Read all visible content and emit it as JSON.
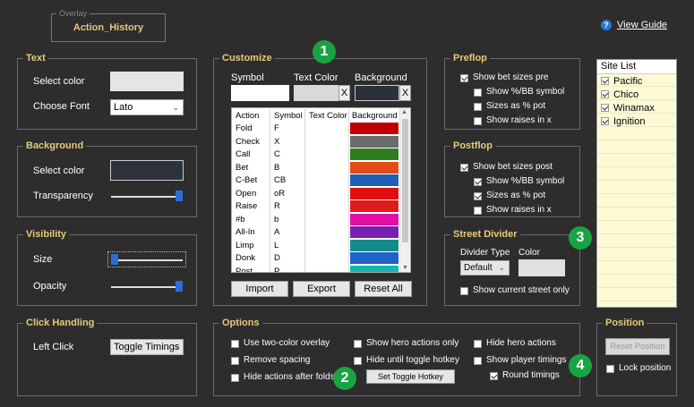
{
  "overlay": {
    "caption": "Overlay",
    "name": "Action_History"
  },
  "guide": {
    "label": "View Guide",
    "icon": "help-icon"
  },
  "text_group": {
    "title": "Text",
    "select_color": "Select color",
    "choose_font": "Choose Font",
    "font_value": "Lato",
    "swatch_color": "#e5e5e5"
  },
  "background_group": {
    "title": "Background",
    "select_color": "Select color",
    "transparency": "Transparency",
    "swatch_color": "#2c323a",
    "transparency_level": 1.0
  },
  "visibility_group": {
    "title": "Visibility",
    "size": "Size",
    "opacity": "Opacity",
    "size_level": 0.0,
    "opacity_level": 1.0
  },
  "click_group": {
    "title": "Click Handling",
    "left_click": "Left Click",
    "left_click_value": "Toggle Timings"
  },
  "customize": {
    "title": "Customize",
    "col_symbol": "Symbol",
    "col_text_color": "Text Color",
    "col_background": "Background",
    "clear": "X",
    "headers": [
      "Action",
      "Symbol",
      "Text Color",
      "Background"
    ],
    "rows": [
      {
        "action": "Fold",
        "symbol": "F",
        "color": "#c00000"
      },
      {
        "action": "Check",
        "symbol": "X",
        "color": "#6b6b6b"
      },
      {
        "action": "Call",
        "symbol": "C",
        "color": "#2e7d1e"
      },
      {
        "action": "Bet",
        "symbol": "B",
        "color": "#e54a17"
      },
      {
        "action": "C-Bet",
        "symbol": "CB",
        "color": "#1f5fb5"
      },
      {
        "action": "Open",
        "symbol": "oR",
        "color": "#e01010"
      },
      {
        "action": "Raise",
        "symbol": "R",
        "color": "#e01a1a"
      },
      {
        "action": "#b",
        "symbol": "b",
        "color": "#e20fa5"
      },
      {
        "action": "All-In",
        "symbol": "A",
        "color": "#7a1fb2"
      },
      {
        "action": "Limp",
        "symbol": "L",
        "color": "#168a8a"
      },
      {
        "action": "Donk",
        "symbol": "D",
        "color": "#1f62c8"
      },
      {
        "action": "Post",
        "symbol": "P",
        "color": "#16b3b3"
      }
    ],
    "import": "Import",
    "export": "Export",
    "reset_all": "Reset All"
  },
  "preflop": {
    "title": "Preflop",
    "show_bet": "Show bet sizes pre",
    "show_bb": "Show %/BB symbol",
    "pot": "Sizes as % pot",
    "raises": "Show raises in x"
  },
  "postflop": {
    "title": "Postflop",
    "show_bet": "Show bet sizes post",
    "show_bb": "Show %/BB symbol",
    "pot": "Sizes as % pot",
    "raises": "Show raises in x"
  },
  "street": {
    "title": "Street Divider",
    "divider_type": "Divider Type",
    "color": "Color",
    "divider_value": "Default",
    "show_current": "Show current street only",
    "swatch_color": "#e0e0e0"
  },
  "sites": {
    "title": "Site List",
    "items": [
      "Pacific",
      "Chico",
      "Winamax",
      "Ignition"
    ]
  },
  "options": {
    "title": "Options",
    "two_color": "Use two-color overlay",
    "remove_spacing": "Remove spacing",
    "hide_after_folds": "Hide actions after folds",
    "show_hero_only": "Show hero actions only",
    "hide_until": "Hide until toggle hotkey",
    "set_hotkey": "Set Toggle Hotkey",
    "hide_hero": "Hide hero actions",
    "show_timings": "Show player timings",
    "round_timings": "Round timings"
  },
  "position": {
    "title": "Position",
    "reset": "Reset Position",
    "lock": "Lock position"
  },
  "badges": [
    "1",
    "2",
    "3",
    "4"
  ]
}
